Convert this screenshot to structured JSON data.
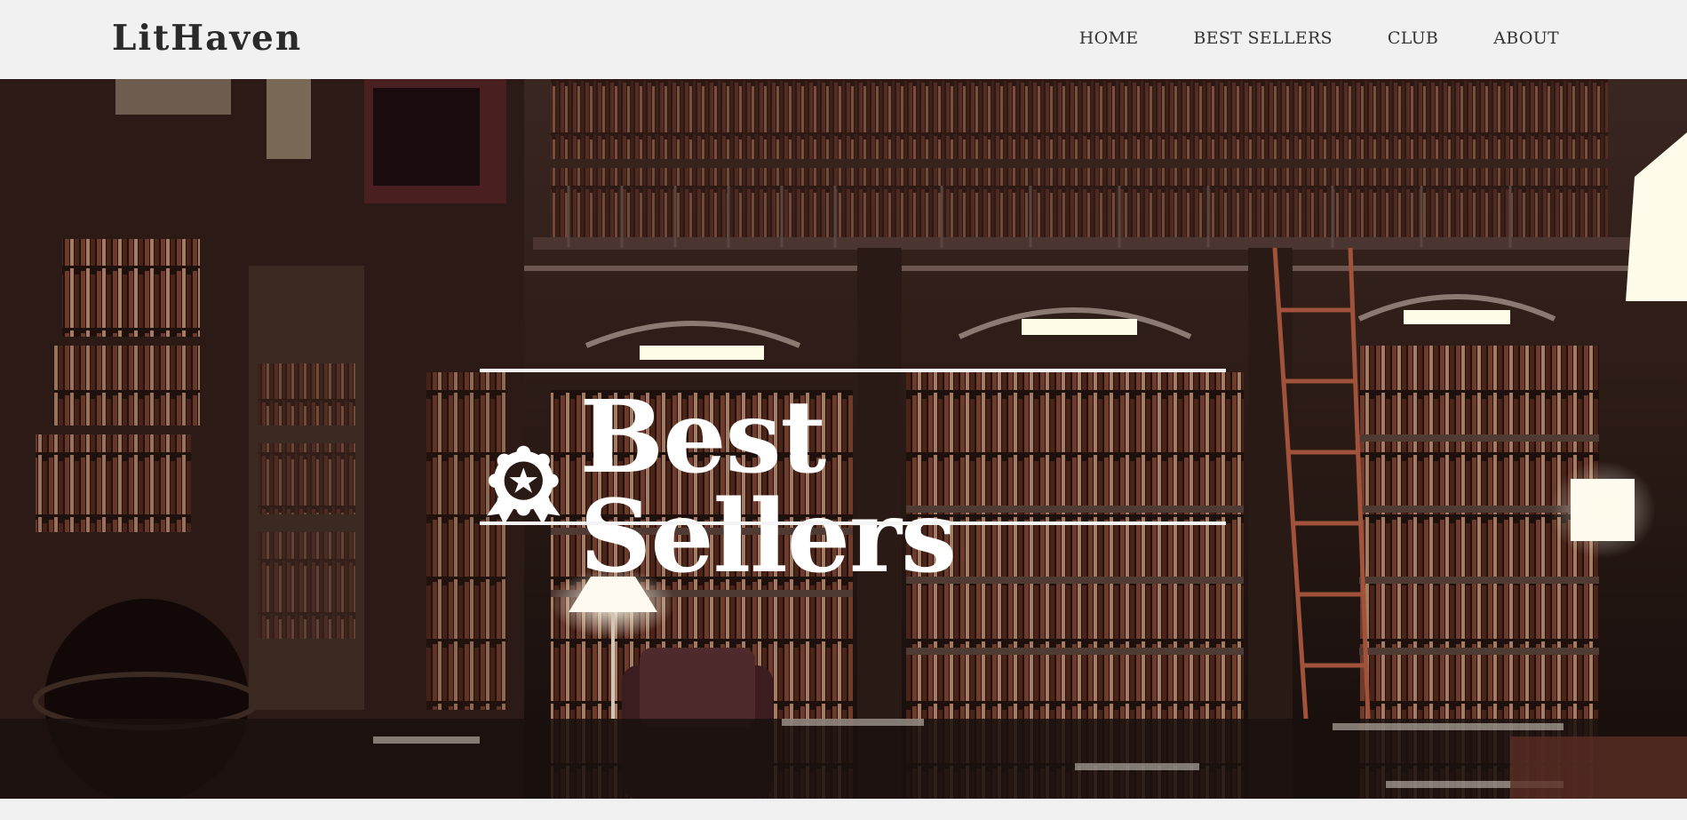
{
  "brand": {
    "name": "LitHaven"
  },
  "nav": {
    "items": [
      {
        "label": "HOME"
      },
      {
        "label": "BEST SELLERS"
      },
      {
        "label": "CLUB"
      },
      {
        "label": "ABOUT"
      }
    ]
  },
  "hero": {
    "title": "Best Sellers",
    "icon": "award-badge-icon",
    "background": "library-interior-image"
  },
  "colors": {
    "topbar_bg": "#f1f1f1",
    "title_text": "#ffffff",
    "logo_text": "#2a2a2a"
  }
}
